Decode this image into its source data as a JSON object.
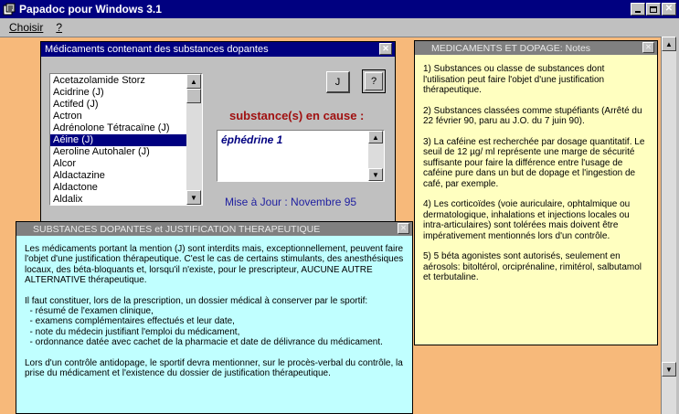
{
  "app": {
    "title": "Papadoc pour Windows 3.1",
    "menu": [
      "Choisir",
      "?"
    ]
  },
  "medicaments": {
    "title": "Médicaments contenant des substances dopantes",
    "items": [
      "Acetazolamide Storz",
      "Acidrine (J)",
      "Actifed (J)",
      "Actron",
      "Adrénolone Tétracaïne (J)",
      "Aéine (J)",
      "Aeroline Autohaler (J)",
      "Alcor",
      "Aldactazine",
      "Aldactone",
      "Aldalix"
    ],
    "selected_index": 5,
    "button_j": "J",
    "button_q": "?",
    "substance_heading": "substance(s) en cause :",
    "substance_value": "éphédrine 1",
    "update_label": "Mise à Jour : Novembre 95"
  },
  "justification": {
    "title": "SUBSTANCES DOPANTES et JUSTIFICATION THERAPEUTIQUE",
    "para1": "Les médicaments portant la mention (J) sont interdits mais, exceptionnellement, peuvent faire l'objet d'une justification thérapeutique. C'est le cas de certains stimulants, des anesthésiques locaux, des béta-bloquants et, lorsqu'il n'existe, pour le prescripteur, AUCUNE AUTRE ALTERNATIVE thérapeutique.",
    "para2_intro": "Il faut constituer, lors de la prescription, un dossier médical à conserver par le sportif:",
    "para2_items": [
      "  - résumé de l'examen clinique,",
      "  - examens complémentaires effectués et leur date,",
      "  - note du médecin justifiant l'emploi du médicament,",
      "  - ordonnance datée avec cachet de la pharmacie et date de délivrance du médicament."
    ],
    "para3": "Lors d'un contrôle antidopage, le sportif devra mentionner, sur le procès-verbal du contrôle, la prise du médicament et l'existence du dossier de justification thérapeutique."
  },
  "notes": {
    "title": "MEDICAMENTS ET DOPAGE: Notes",
    "items": [
      "1) Substances ou classe de substances dont l'utilisation peut faire l'objet d'une justification thérapeutique.",
      "2) Substances classées comme stupéfiants (Arrêté du 22 février 90, paru au J.O. du 7 juin 90).",
      "3) La caféine est recherchée par dosage quantitatif. Le seuil de 12 µg/ ml représente une marge de sécurité suffisante pour faire la différence entre l'usage de caféine pure dans un but de dopage et l'ingestion de café, par exemple.",
      "4) Les corticoïdes (voie auriculaire, ophtalmique ou dermatologique, inhalations et injections locales ou intra-articulaires) sont tolérées mais doivent être impérativement mentionnés lors d'un contrôle.",
      "5) 5 béta agonistes sont autorisés, seulement en aérosols: bitoltérol, orciprénaline, rimitérol, salbutamol et terbutaline."
    ]
  },
  "colors": {
    "title_active": "#000080",
    "title_inactive": "#808080",
    "workspace": "#f7b97a",
    "notes_bg": "#ffffc0",
    "justif_bg": "#c0ffff",
    "heading_red": "#a01010",
    "update_blue": "#2020a0"
  }
}
